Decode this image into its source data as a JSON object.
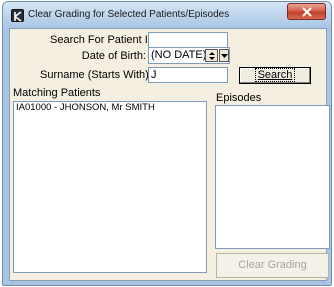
{
  "window": {
    "title": "Clear Grading for Selected Patients/Episodes"
  },
  "form": {
    "patient_id_label": "Search For Patient ID:",
    "patient_id_value": "",
    "dob_label": "Date of Birth:",
    "dob_value": "(NO DATE)",
    "surname_label": "Surname (Starts With):",
    "surname_value": "J",
    "search_button": "Search"
  },
  "matching_patients": {
    "label": "Matching Patients",
    "items": [
      "IA01000 - JHONSON, Mr SMITH"
    ]
  },
  "episodes": {
    "label": "Episodes",
    "items": []
  },
  "actions": {
    "clear_grading_button": "Clear Grading",
    "clear_grading_enabled": false
  },
  "icons": {
    "app": "app-icon",
    "close": "close-icon",
    "spin": "spin-updown-icon",
    "dropdown": "chevron-down-icon"
  }
}
